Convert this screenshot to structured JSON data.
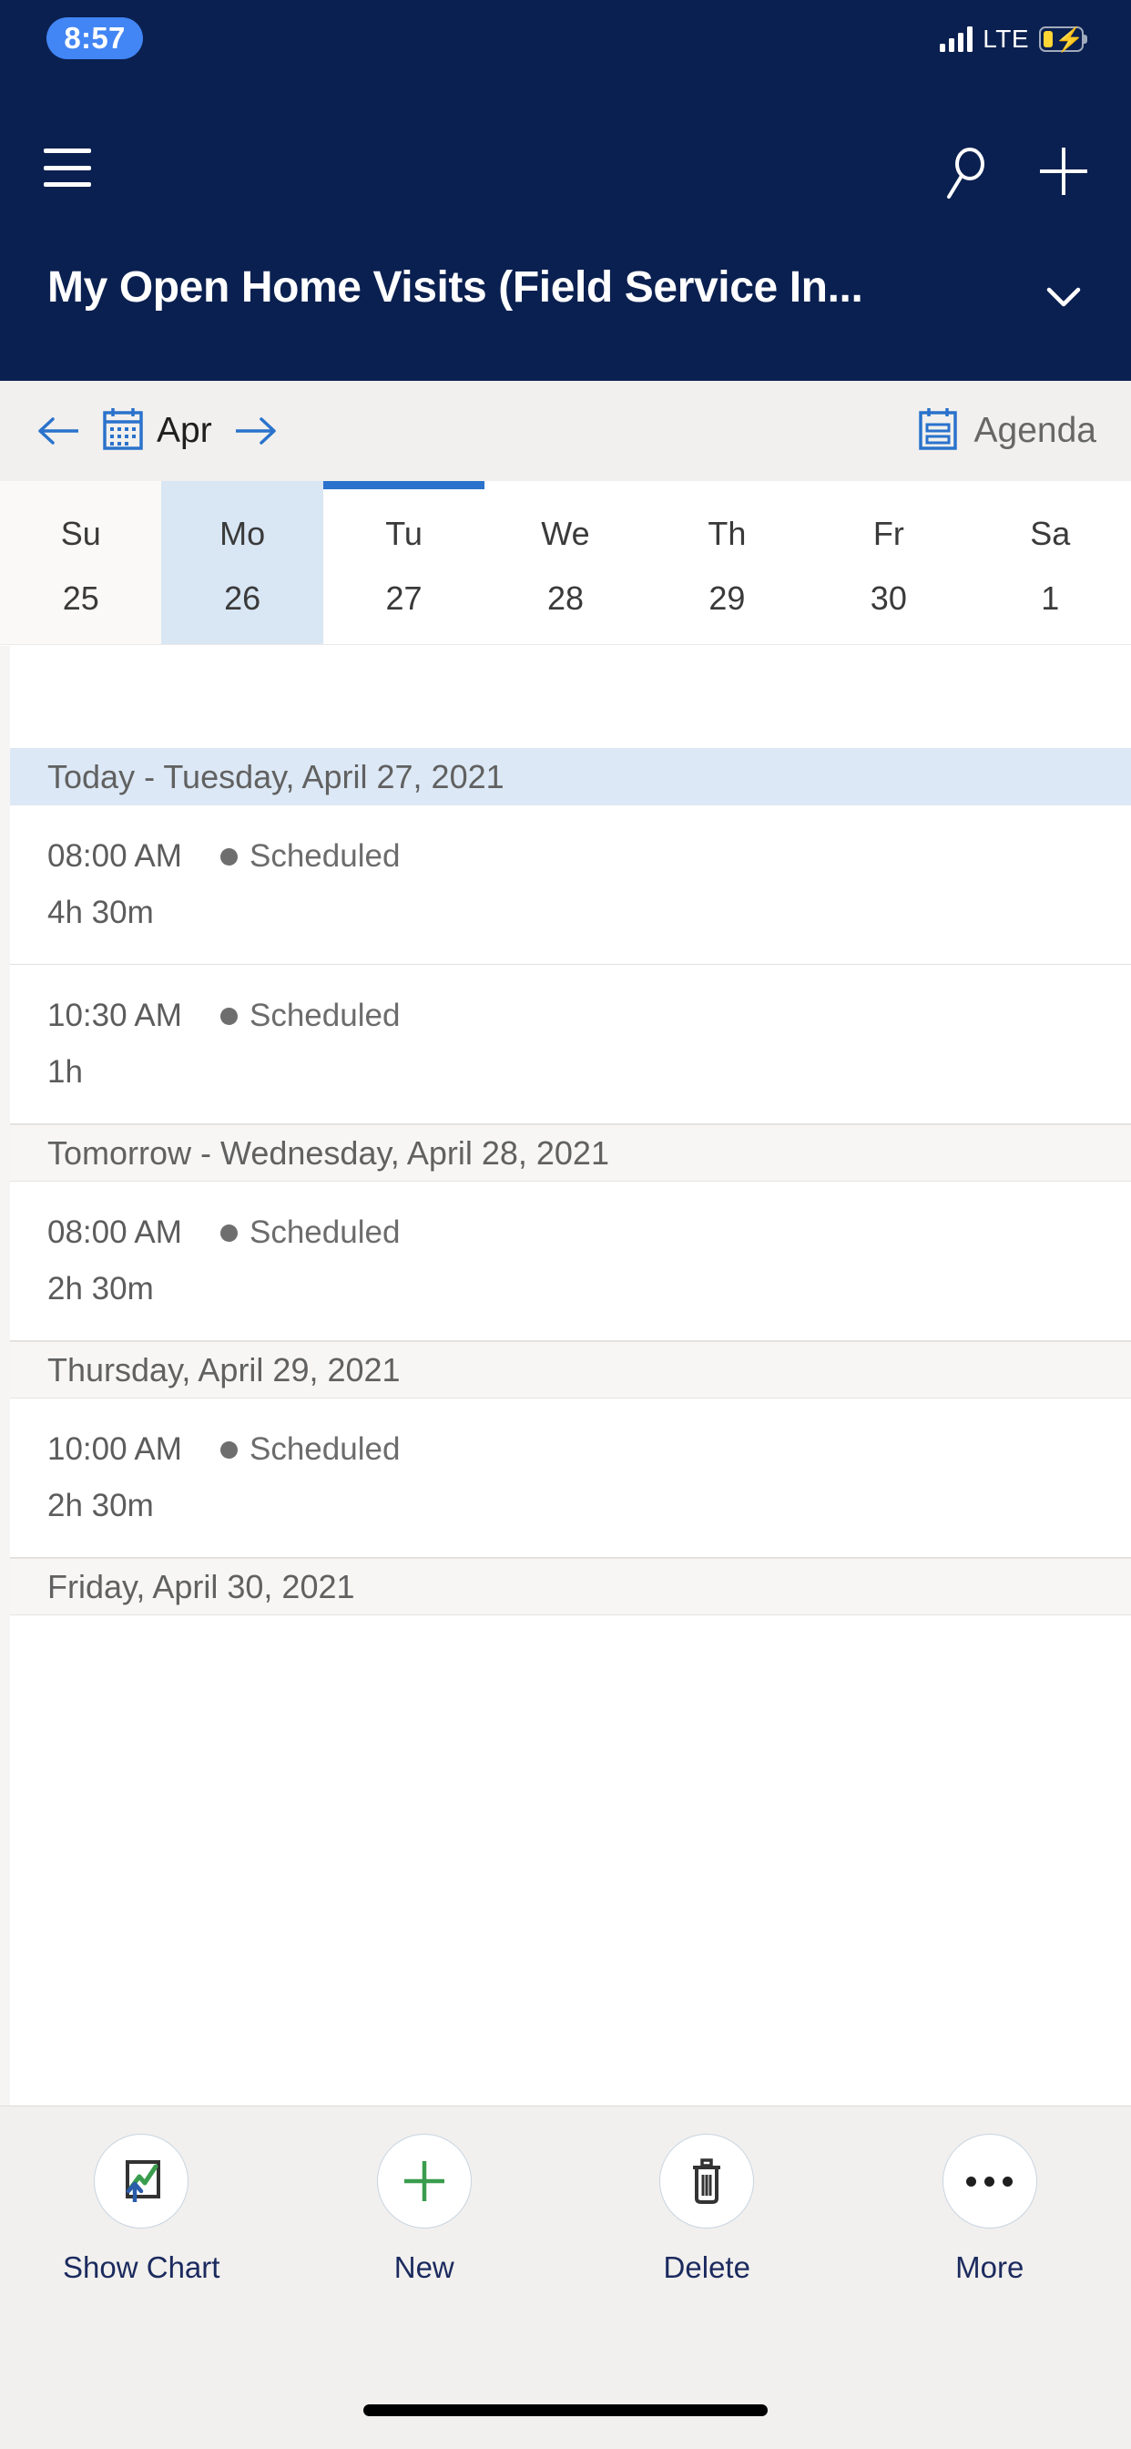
{
  "status_bar": {
    "time": "8:57",
    "network_label": "LTE",
    "signal_icon": "signal-bars-icon",
    "battery_icon": "battery-charging-icon",
    "signal_bars": 4
  },
  "nav": {
    "menu_icon": "hamburger-menu-icon",
    "search_icon": "search-icon",
    "add_icon": "plus-icon"
  },
  "header": {
    "title": "My Open Home Visits (Field Service In...",
    "chevron_icon": "chevron-down-icon"
  },
  "calendar_toolbar": {
    "prev_icon": "arrow-left-icon",
    "next_icon": "arrow-right-icon",
    "calendar_icon": "calendar-icon",
    "month": "Apr",
    "view_icon": "agenda-icon",
    "view_label": "Agenda"
  },
  "week_strip": {
    "days": [
      {
        "dow": "Su",
        "num": "25",
        "state": "weekend"
      },
      {
        "dow": "Mo",
        "num": "26",
        "state": "selected"
      },
      {
        "dow": "Tu",
        "num": "27",
        "state": "today"
      },
      {
        "dow": "We",
        "num": "28",
        "state": "normal"
      },
      {
        "dow": "Th",
        "num": "29",
        "state": "normal"
      },
      {
        "dow": "Fr",
        "num": "30",
        "state": "normal"
      },
      {
        "dow": "Sa",
        "num": "1",
        "state": "normal"
      }
    ]
  },
  "agenda": {
    "sections": [
      {
        "header": "Today - Tuesday, April 27, 2021",
        "is_today": true,
        "appointments": [
          {
            "time": "08:00 AM",
            "status": "Scheduled",
            "duration": "4h 30m"
          },
          {
            "time": "10:30 AM",
            "status": "Scheduled",
            "duration": "1h"
          }
        ]
      },
      {
        "header": "Tomorrow - Wednesday, April 28, 2021",
        "is_today": false,
        "appointments": [
          {
            "time": "08:00 AM",
            "status": "Scheduled",
            "duration": "2h 30m"
          }
        ]
      },
      {
        "header": "Thursday, April 29, 2021",
        "is_today": false,
        "appointments": [
          {
            "time": "10:00 AM",
            "status": "Scheduled",
            "duration": "2h 30m"
          }
        ]
      },
      {
        "header": "Friday, April 30, 2021",
        "is_today": false,
        "appointments": []
      }
    ]
  },
  "bottom_toolbar": {
    "commands": [
      {
        "label": "Show Chart",
        "icon": "show-chart-icon"
      },
      {
        "label": "New",
        "icon": "plus-icon"
      },
      {
        "label": "Delete",
        "icon": "trash-icon"
      },
      {
        "label": "More",
        "icon": "more-ellipsis-icon"
      }
    ]
  },
  "colors": {
    "header_navy": "#0a2050",
    "accent_blue": "#2a72cc",
    "today_highlight": "#dce8f5",
    "selected_day": "#d9e6f4",
    "toolbar_bg": "#f1f0ee",
    "status_dot": "#6e6e6e",
    "new_green": "#3a9d4e",
    "time_pill": "#4285f4"
  }
}
